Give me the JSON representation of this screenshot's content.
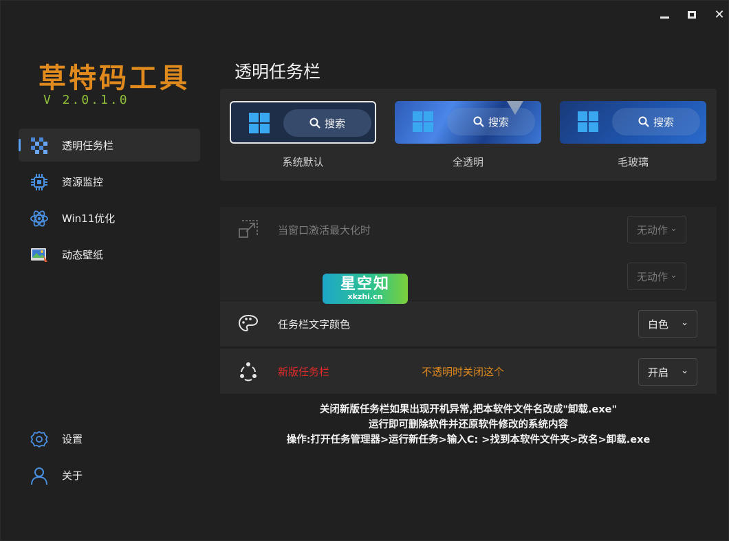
{
  "app": {
    "logo_text": "草特码工具",
    "version": "V 2.0.1.0"
  },
  "window_controls": {
    "minimize": "minimize",
    "maximize": "maximize",
    "close": "✕"
  },
  "sidebar": {
    "items": [
      {
        "label": "透明任务栏",
        "icon": "checker-icon",
        "active": true
      },
      {
        "label": "资源监控",
        "icon": "cpu-chip-icon",
        "active": false
      },
      {
        "label": "Win11优化",
        "icon": "atom-icon",
        "active": false
      },
      {
        "label": "动态壁纸",
        "icon": "wallpaper-icon",
        "active": false
      }
    ],
    "bottom_items": [
      {
        "label": "设置",
        "icon": "gear-icon"
      },
      {
        "label": "关于",
        "icon": "user-icon"
      }
    ]
  },
  "main": {
    "title": "透明任务栏",
    "themes": [
      {
        "label": "系统默认",
        "search_text": "搜索",
        "selected": true
      },
      {
        "label": "全透明",
        "search_text": "搜索",
        "selected": false
      },
      {
        "label": "毛玻璃",
        "search_text": "搜索",
        "selected": false
      }
    ],
    "rows": [
      {
        "label": "当窗口激活最大化时",
        "value": "无动作",
        "enabled": false,
        "icon": "maximize-window-icon"
      },
      {
        "label": "",
        "value": "无动作",
        "enabled": false,
        "icon": ""
      },
      {
        "label": "任务栏文字颜色",
        "value": "白色",
        "enabled": true,
        "icon": "palette-icon"
      },
      {
        "label": "新版任务栏",
        "hint": "不透明时关闭这个",
        "value": "开启",
        "enabled": true,
        "icon": "refresh-nodes-icon"
      }
    ],
    "notice": [
      "关闭新版任务栏如果出现开机异常,把本软件文件名改成\"卸载.exe\"",
      "运行即可删除软件并还原软件修改的系统内容",
      "操作:打开任务管理器>运行新任务>输入C: >找到本软件文件夹>改名>卸载.exe"
    ]
  },
  "watermark": {
    "main": "星空知",
    "sub": "xkzhi.cn"
  },
  "colors": {
    "accent": "#5ba4f5",
    "logo": "#e08a1e",
    "version": "#8fbf3a",
    "new_taskbar_label": "#e02a2a",
    "hint": "#e08a1e"
  }
}
